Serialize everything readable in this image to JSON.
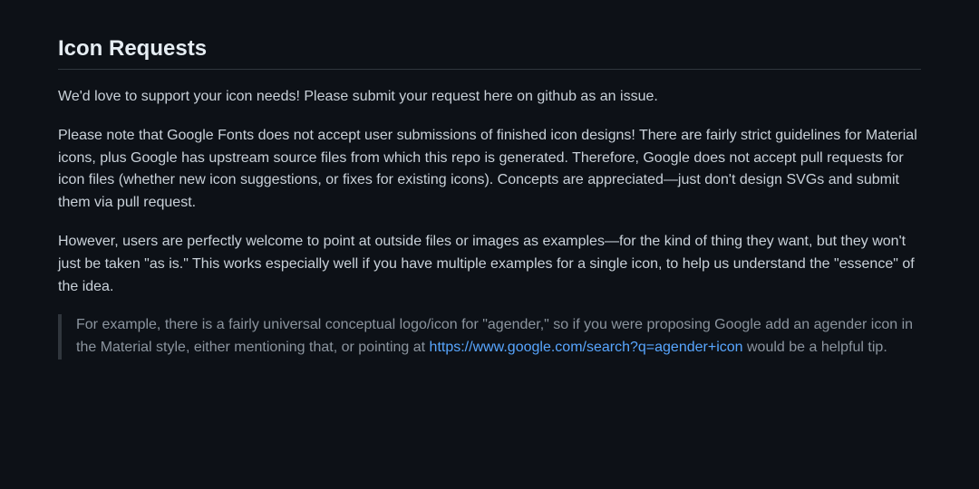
{
  "heading": "Icon Requests",
  "para1": "We'd love to support your icon needs! Please submit your request here on github as an issue.",
  "para2": "Please note that Google Fonts does not accept user submissions of finished icon designs! There are fairly strict guidelines for Material icons, plus Google has upstream source files from which this repo is generated. Therefore, Google does not accept pull requests for icon files (whether new icon suggestions, or fixes for existing icons). Concepts are appreciated—just don't design SVGs and submit them via pull request.",
  "para3": "However, users are perfectly welcome to point at outside files or images as examples—for the kind of thing they want, but they won't just be taken \"as is.\" This works especially well if you have multiple examples for a single icon, to help us understand the \"essence\" of the idea.",
  "quote_before_link": "For example, there is a fairly universal conceptual logo/icon for \"agender,\" so if you were proposing Google add an agender icon in the Material style, either mentioning that, or pointing at ",
  "quote_link_text": "https://www.google.com/search?q=agender+icon",
  "quote_link_href": "https://www.google.com/search?q=agender+icon",
  "quote_after_link": " would be a helpful tip."
}
